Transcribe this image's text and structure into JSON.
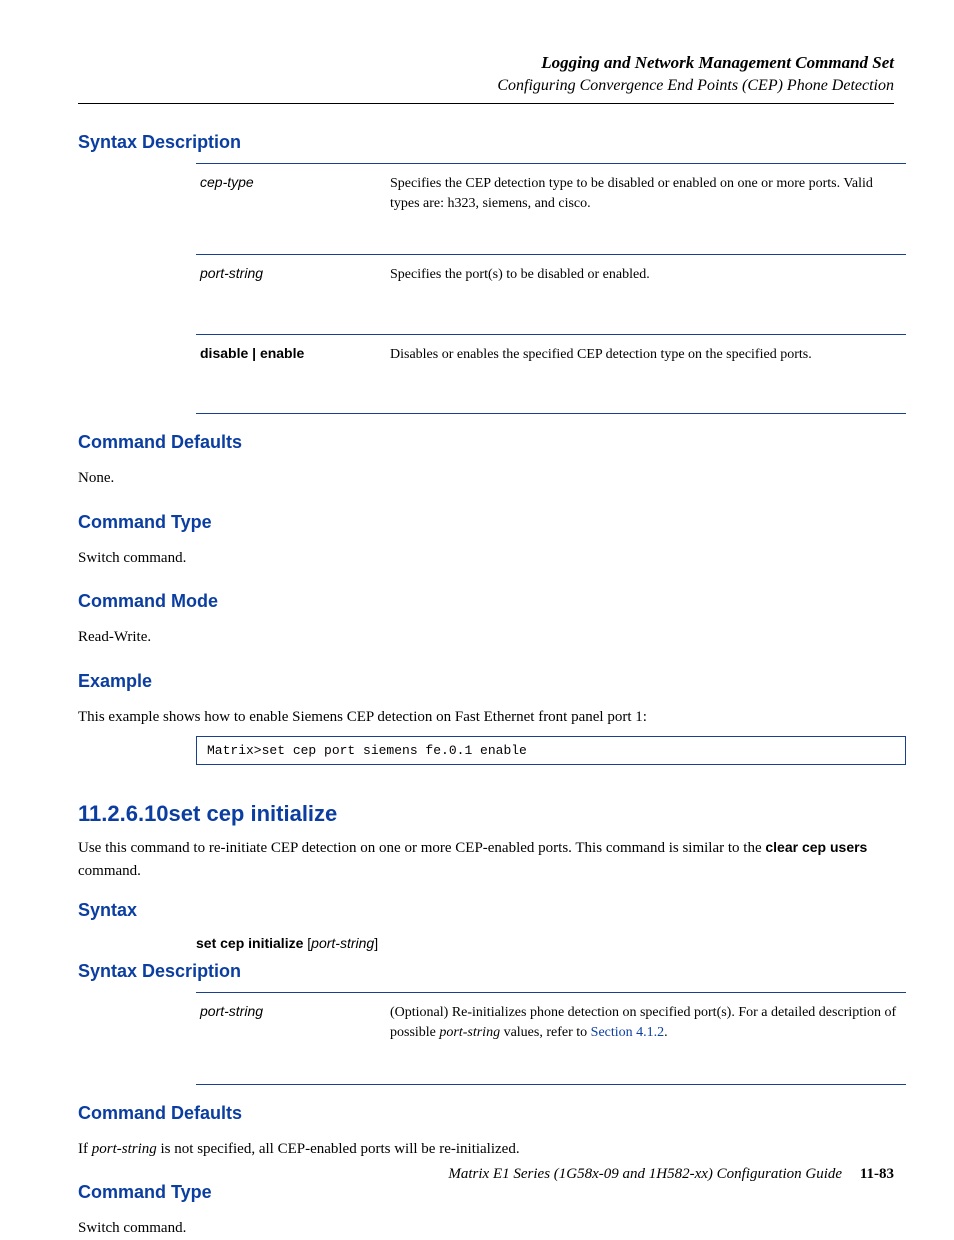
{
  "header": {
    "line1": "Logging and Network Management Command Set",
    "line2": "Configuring Convergence End Points (CEP) Phone Detection"
  },
  "sections": {
    "syntax_description": {
      "title": "Syntax Description",
      "rows": [
        {
          "param": "cep-type",
          "desc": "Specifies the CEP detection type to be disabled or enabled on one or more ports. Valid types are: h323, siemens, and cisco."
        },
        {
          "param": "port-string",
          "desc": "Specifies the port(s) to be disabled or enabled."
        },
        {
          "param": "disable | enable",
          "desc": "Disables or enables the specified CEP detection type on the specified ports."
        }
      ]
    },
    "command_defaults": {
      "title": "Command Defaults",
      "text": "None."
    },
    "command_type": {
      "title": "Command Type",
      "text": "Switch command."
    },
    "command_mode": {
      "title": "Command Mode",
      "text": "Read-Write."
    },
    "example": {
      "title": "Example",
      "text_prefix": "This example shows how to enable Siemens CEP detection on Fast Ethernet front panel port 1: ",
      "code": "Matrix>set cep port siemens fe.0.1 enable"
    },
    "new_command": {
      "number": "11.2.6.10",
      "name": "set cep initialize",
      "description_pre": "Use this command to re-initiate CEP detection on one or more CEP-enabled ports. This command is similar to the ",
      "description_bold": "clear cep users",
      "description_post": " command."
    },
    "syntax2": {
      "title": "Syntax",
      "cmd": "set cep initialize",
      "opt": "[port-string]"
    },
    "syntax_description2": {
      "title": "Syntax Description",
      "rows": [
        {
          "param": "port-string",
          "desc_pre": "(Optional) Re-initializes phone detection on specified port(s). For a detailed description of possible ",
          "desc_ital": "port-string",
          "desc_mid": " values, refer to ",
          "desc_link": "Section 4.1.2",
          "desc_post": "."
        }
      ]
    },
    "command_defaults2": {
      "title": "Command Defaults",
      "text_pre": "If ",
      "text_ital": "port-string",
      "text_post": " is not specified, all CEP-enabled ports will be re-initialized."
    },
    "command_type2": {
      "title": "Command Type",
      "text": "Switch command."
    }
  },
  "footer": {
    "text": "Matrix E1 Series (1G58x-09 and 1H582-xx) Configuration Guide",
    "page": "11-83"
  }
}
